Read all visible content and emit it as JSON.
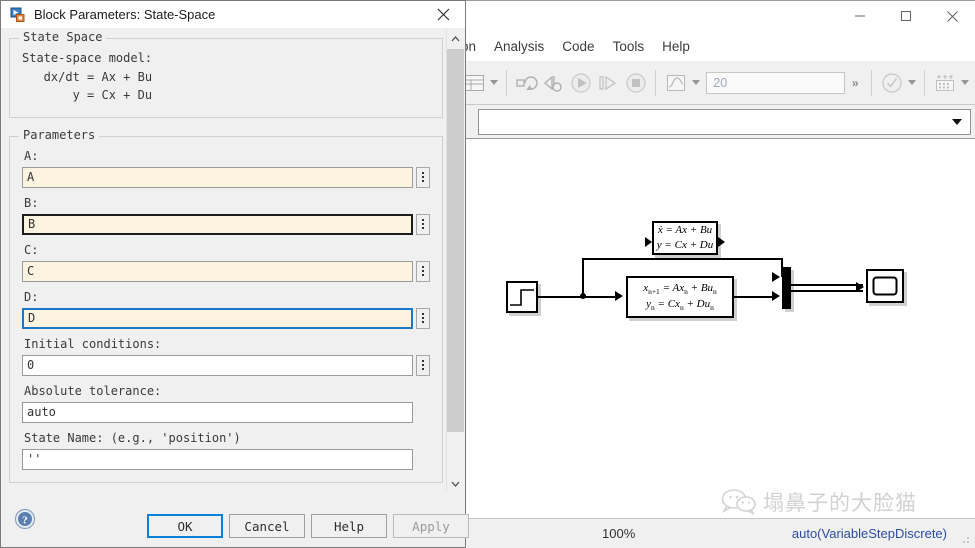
{
  "simulink": {
    "window_controls": {
      "minimize": "minimize-icon",
      "maximize": "maximize-icon",
      "close": "close-icon"
    },
    "menu": [
      {
        "label": "ion",
        "name": "menu-simulation-clipped"
      },
      {
        "label": "Analysis",
        "name": "menu-analysis"
      },
      {
        "label": "Code",
        "name": "menu-code"
      },
      {
        "label": "Tools",
        "name": "menu-tools"
      },
      {
        "label": "Help",
        "name": "menu-help"
      }
    ],
    "toolbar": {
      "model_browser_icon": "model-browser-icon",
      "update_model_icon": "update-model-icon",
      "build_model_icon": "build-model-icon",
      "run_icon": "run-icon",
      "step_forward_icon": "step-forward-icon",
      "stop_icon": "stop-icon",
      "scope_icon": "scope-icon",
      "sim_time_value": "20",
      "overflow_label": "»",
      "model_advisor_icon": "model-advisor-check-icon",
      "data_inspector_icon": "data-inspector-icon"
    },
    "statusbar": {
      "zoom": "100%",
      "solver": "auto(VariableStepDiscrete)"
    },
    "watermark": {
      "text": "塌鼻子的大脸猫",
      "logo": "wechat-bubble-icon"
    },
    "diagram": {
      "step_block": {
        "name": "step-block",
        "icon": "step-signal-icon"
      },
      "continuous_ss": {
        "name": "continuous-state-space-block",
        "line1": "ẋ = Ax + Bu",
        "line2": "y = Cx + Du"
      },
      "discrete_ss": {
        "name": "discrete-state-space-block",
        "line1_a": "x",
        "line1_sub1": "n+1",
        "line1_b": " = Ax",
        "line1_sub2": "n",
        "line1_c": " + Bu",
        "line1_sub3": "n",
        "line2_a": "y",
        "line2_sub1": "n",
        "line2_b": " = Cx",
        "line2_sub2": "n",
        "line2_c": " + Du",
        "line2_sub3": "n"
      },
      "mux_block": {
        "name": "mux-block"
      },
      "scope_block": {
        "name": "scope-block"
      }
    }
  },
  "dialog": {
    "icon": "simulink-block-icon",
    "title": "Block Parameters: State-Space",
    "close_icon": "close-icon",
    "groups": {
      "state_space": {
        "legend": "State Space",
        "description": "State-space model:\n   dx/dt = Ax + Bu\n       y = Cx + Du"
      },
      "parameters": {
        "legend": "Parameters",
        "fields": [
          {
            "label": "A:",
            "value": "A",
            "name": "field-a",
            "style": "cream",
            "selector": "selector-a"
          },
          {
            "label": "B:",
            "value": "B",
            "name": "field-b",
            "style": "cream-strong",
            "selector": "selector-b"
          },
          {
            "label": "C:",
            "value": "C",
            "name": "field-c",
            "style": "cream",
            "selector": "selector-c"
          },
          {
            "label": "D:",
            "value": "D",
            "name": "field-d",
            "style": "cream-focus",
            "selector": "selector-d"
          },
          {
            "label": "Initial conditions:",
            "value": "0",
            "name": "field-initial-conditions",
            "style": "plain",
            "selector": "selector-initial-conditions"
          },
          {
            "label": "Absolute tolerance:",
            "value": "auto",
            "name": "field-absolute-tolerance",
            "style": "plain-nosel"
          },
          {
            "label": "State Name: (e.g., 'position')",
            "value": "''",
            "name": "field-state-name",
            "style": "plain-nosel"
          }
        ]
      }
    },
    "footer": {
      "help_icon": "help-question-icon",
      "ok": "OK",
      "cancel": "Cancel",
      "help": "Help",
      "apply": "Apply"
    },
    "scrollbar": {
      "up": "▲",
      "down": "▼"
    }
  }
}
